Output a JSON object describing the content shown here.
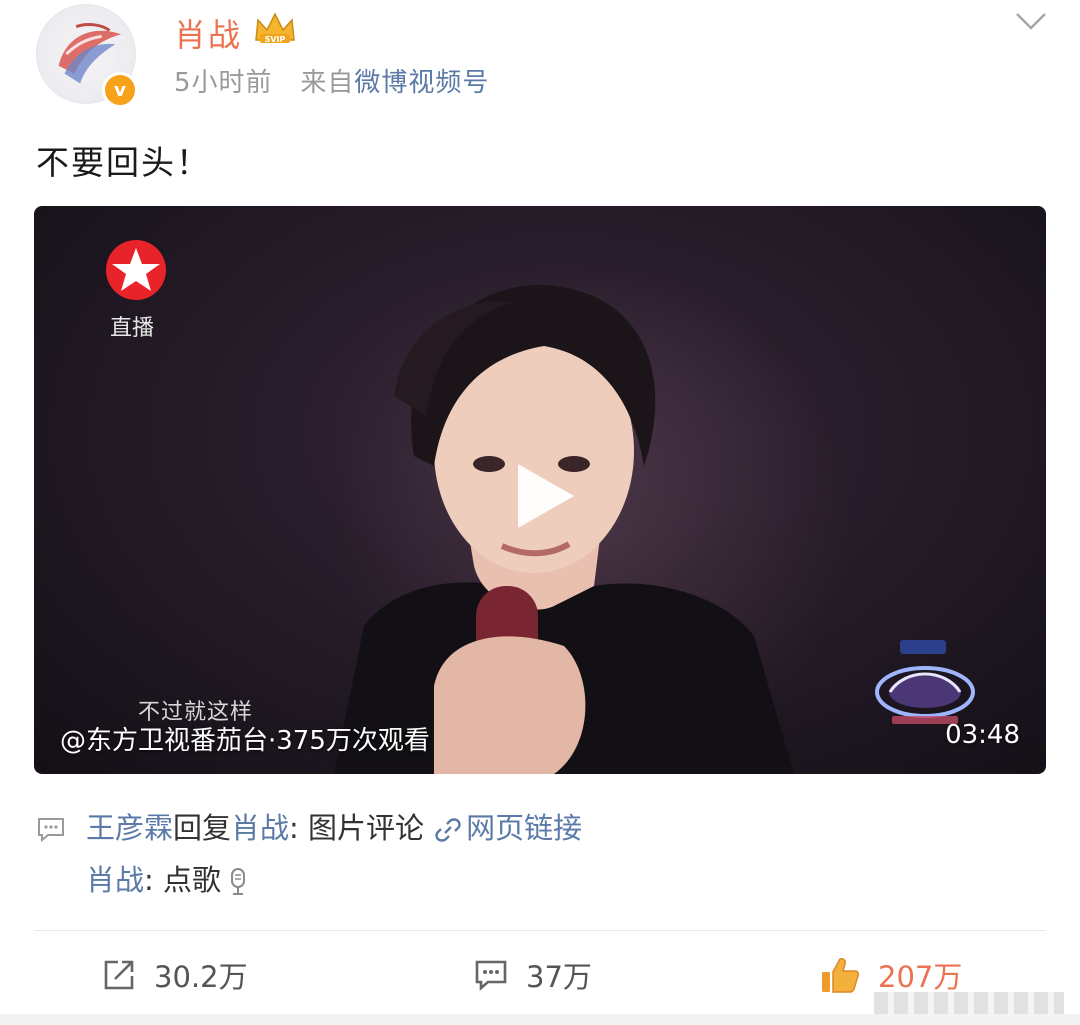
{
  "post": {
    "author": "肖战",
    "time": "5小时前",
    "source_prefix": "来自",
    "source": "微博视频号",
    "text": "不要回头！"
  },
  "video": {
    "channel_label": "直播",
    "subtitle": "不过就这样",
    "info": "@东方卫视番茄台·375万次观看",
    "duration": "03:48"
  },
  "comments": [
    {
      "author": "王彦霖",
      "verb": "回复",
      "target": "肖战",
      "colon": ": ",
      "text": "图片评论",
      "link_text": "网页链接"
    },
    {
      "author": "肖战",
      "colon": ": ",
      "text": "点歌"
    }
  ],
  "actions": {
    "repost_count": "30.2万",
    "comment_count": "37万",
    "like_count": "207万"
  },
  "colors": {
    "accent": "#eb7350",
    "link": "#5c7aa8",
    "verified": "#f7a21b"
  }
}
